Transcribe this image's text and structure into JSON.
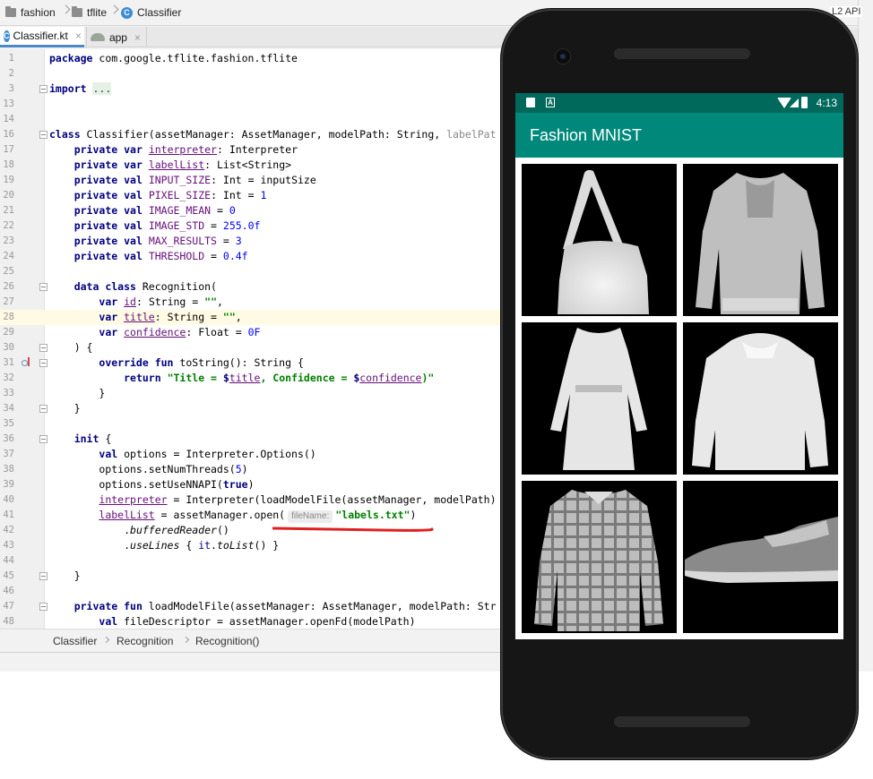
{
  "ide": {
    "breadcrumbs": [
      {
        "label": "fashion",
        "icon": "folder-icon"
      },
      {
        "label": "tflite",
        "icon": "folder-icon"
      },
      {
        "label": "Classifier",
        "icon": "kotlin-class-icon"
      }
    ],
    "top_right_fragment": "L2 API",
    "tabs": [
      {
        "label": "Classifier.kt",
        "icon": "kotlin-class-icon",
        "active": true
      },
      {
        "label": "app",
        "icon": "android-module-icon",
        "active": false
      }
    ],
    "code_lines": [
      {
        "n": "1",
        "t": "package com.google.tflite.fashion.tflite"
      },
      {
        "n": "2",
        "t": ""
      },
      {
        "n": "3",
        "t": "import ..."
      },
      {
        "n": "13",
        "t": ""
      },
      {
        "n": "14",
        "t": ""
      },
      {
        "n": "16",
        "t": "class Classifier(assetManager: AssetManager, modelPath: String, labelPat"
      },
      {
        "n": "17",
        "t": "    private var interpreter: Interpreter"
      },
      {
        "n": "18",
        "t": "    private var labelList: List<String>"
      },
      {
        "n": "19",
        "t": "    private val INPUT_SIZE: Int = inputSize"
      },
      {
        "n": "20",
        "t": "    private val PIXEL_SIZE: Int = 1"
      },
      {
        "n": "21",
        "t": "    private val IMAGE_MEAN = 0"
      },
      {
        "n": "22",
        "t": "    private val IMAGE_STD = 255.0f"
      },
      {
        "n": "23",
        "t": "    private val MAX_RESULTS = 3"
      },
      {
        "n": "24",
        "t": "    private val THRESHOLD = 0.4f"
      },
      {
        "n": "25",
        "t": ""
      },
      {
        "n": "26",
        "t": "    data class Recognition("
      },
      {
        "n": "27",
        "t": "        var id: String = \"\","
      },
      {
        "n": "28",
        "t": "        var title: String = \"\","
      },
      {
        "n": "29",
        "t": "        var confidence: Float = 0F"
      },
      {
        "n": "30",
        "t": "    ) {"
      },
      {
        "n": "31",
        "t": "        override fun toString(): String {"
      },
      {
        "n": "32",
        "t": "            return \"Title = $title, Confidence = $confidence)\""
      },
      {
        "n": "33",
        "t": "        }"
      },
      {
        "n": "34",
        "t": "    }"
      },
      {
        "n": "35",
        "t": ""
      },
      {
        "n": "36",
        "t": "    init {"
      },
      {
        "n": "37",
        "t": "        val options = Interpreter.Options()"
      },
      {
        "n": "38",
        "t": "        options.setNumThreads(5)"
      },
      {
        "n": "39",
        "t": "        options.setUseNNAPI(true)"
      },
      {
        "n": "40",
        "t": "        interpreter = Interpreter(loadModelFile(assetManager, modelPath)"
      },
      {
        "n": "41",
        "t": "        labelList = assetManager.open( fileName: \"labels.txt\")"
      },
      {
        "n": "42",
        "t": "            .bufferedReader()"
      },
      {
        "n": "43",
        "t": "            .useLines { it.toList() }"
      },
      {
        "n": "44",
        "t": ""
      },
      {
        "n": "45",
        "t": "    }"
      },
      {
        "n": "46",
        "t": ""
      },
      {
        "n": "47",
        "t": "    private fun loadModelFile(assetManager: AssetManager, modelPath: Str"
      },
      {
        "n": "48",
        "t": "        val fileDescriptor = assetManager.openFd(modelPath)"
      }
    ],
    "param_hint": "fileName:",
    "status_breadcrumbs": [
      "Classifier",
      "Recognition",
      "Recognition()"
    ]
  },
  "phone": {
    "time": "4:13",
    "app_title": "Fashion MNIST",
    "images": [
      {
        "name": "bag-image",
        "item": "bag"
      },
      {
        "name": "pullover-image",
        "item": "pullover"
      },
      {
        "name": "dress-image",
        "item": "dress"
      },
      {
        "name": "coat-image",
        "item": "coat"
      },
      {
        "name": "shirt-image",
        "item": "shirt"
      },
      {
        "name": "sneaker-image",
        "item": "sneaker"
      }
    ],
    "nav_icons": [
      "back-icon",
      "home-icon",
      "recents-icon"
    ],
    "colors": {
      "status_bar": "#00695c",
      "app_bar": "#00897b"
    }
  }
}
